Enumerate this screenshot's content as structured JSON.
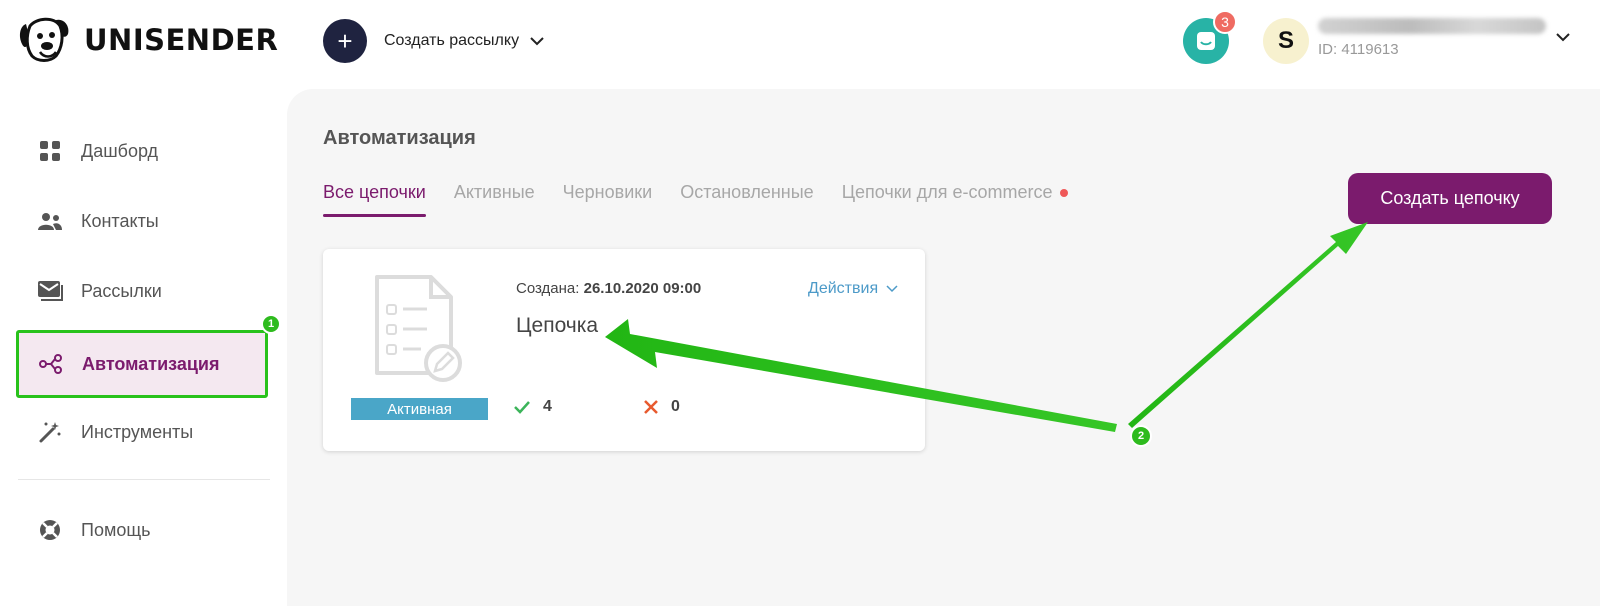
{
  "header": {
    "logo_text": "UNISENDER",
    "create_label": "Создать рассылку",
    "notifications_count": "3",
    "avatar_initial": "S",
    "user_id": "ID: 4119613"
  },
  "sidebar": {
    "items": [
      {
        "label": "Дашборд",
        "icon": "dashboard-icon"
      },
      {
        "label": "Контакты",
        "icon": "contacts-icon"
      },
      {
        "label": "Рассылки",
        "icon": "mailings-icon"
      },
      {
        "label": "Автоматизация",
        "icon": "automation-icon",
        "active": true
      },
      {
        "label": "Инструменты",
        "icon": "magic-wand-icon"
      }
    ],
    "help_label": "Помощь"
  },
  "main": {
    "title": "Автоматизация",
    "tabs": [
      {
        "label": "Все цепочки",
        "active": true
      },
      {
        "label": "Активные"
      },
      {
        "label": "Черновики"
      },
      {
        "label": "Остановленные"
      },
      {
        "label": "Цепочки для e-commerce",
        "dot": true
      }
    ],
    "create_button": "Создать цепочку",
    "card": {
      "created_label": "Создана:",
      "created_value": "26.10.2020 09:00",
      "name": "Цепочка",
      "actions_label": "Действия",
      "status": "Активная",
      "success_count": "4",
      "fail_count": "0"
    }
  },
  "annotations": {
    "marker_1": "1",
    "marker_2": "2"
  },
  "colors": {
    "brand": "#7b1b6d",
    "annotation_green": "#2ebb1e",
    "status_blue": "#4aa6c8",
    "notif_teal": "#28b3a6"
  }
}
